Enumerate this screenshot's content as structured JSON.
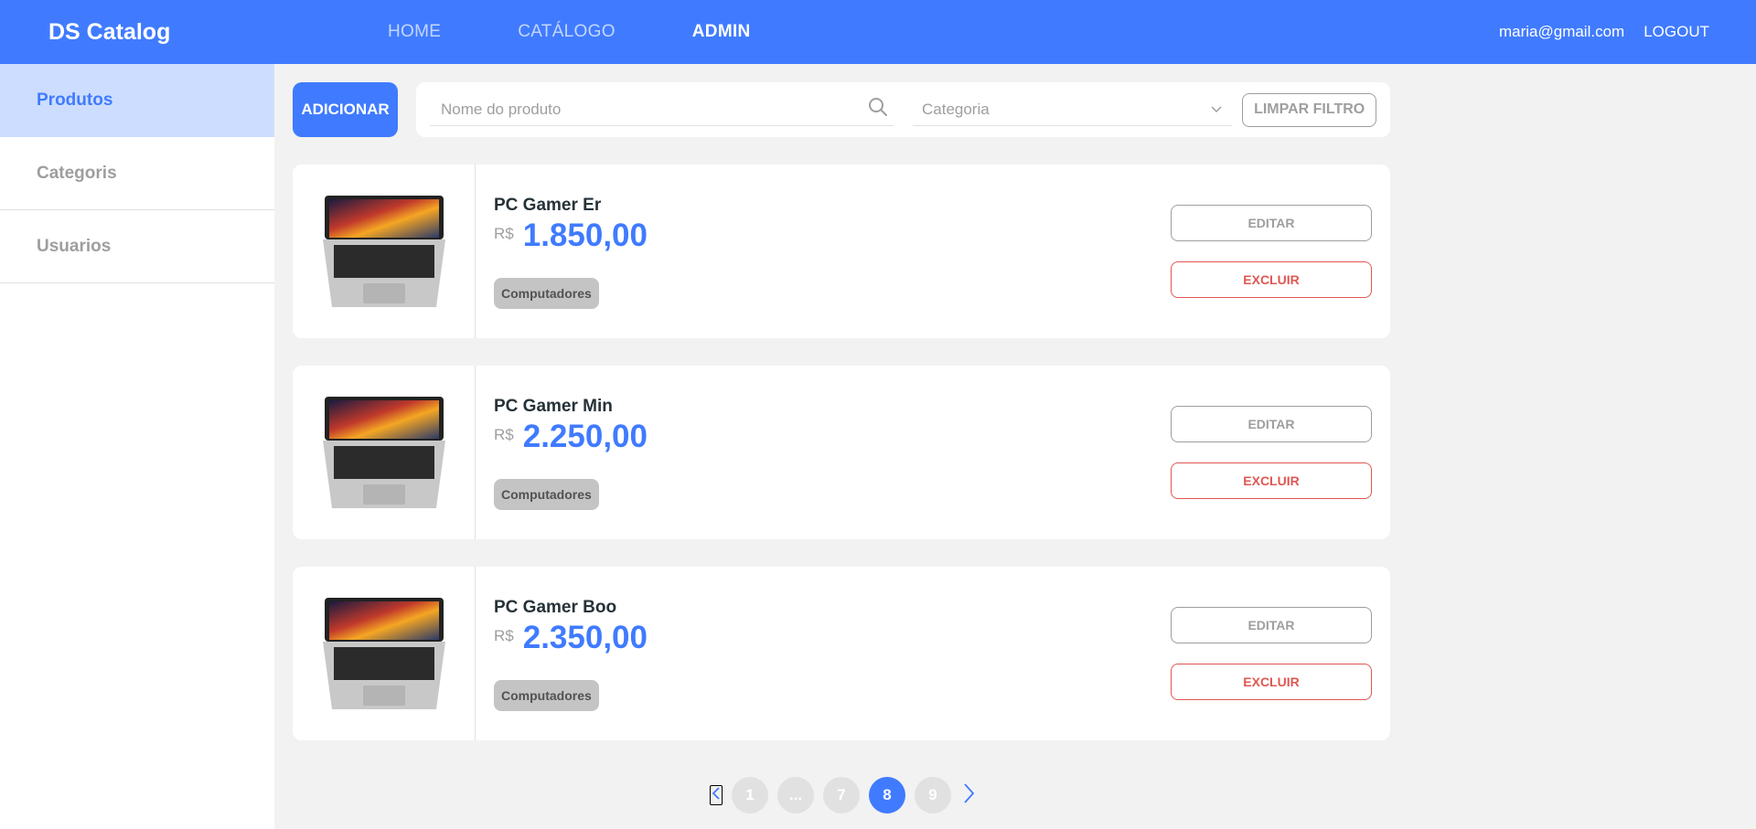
{
  "navbar": {
    "brand": "DS Catalog",
    "links": [
      {
        "label": "HOME"
      },
      {
        "label": "CATÁLOGO"
      },
      {
        "label": "ADMIN"
      }
    ],
    "user_email": "maria@gmail.com",
    "logout_label": "LOGOUT",
    "bg_color": "#407bff"
  },
  "sidebar": {
    "items": [
      {
        "label": "Produtos"
      },
      {
        "label": "Categoris"
      },
      {
        "label": "Usuarios"
      }
    ]
  },
  "filters": {
    "add_label": "ADICIONAR",
    "search_placeholder": "Nome do produto",
    "category_placeholder": "Categoria",
    "clear_label": "LIMPAR FILTRO"
  },
  "products": [
    {
      "name": "PC Gamer Er",
      "currency": "R$",
      "price": "1.850,00",
      "category": "Computadores",
      "edit_label": "EDITAR",
      "delete_label": "EXCLUIR"
    },
    {
      "name": "PC Gamer Min",
      "currency": "R$",
      "price": "2.250,00",
      "category": "Computadores",
      "edit_label": "EDITAR",
      "delete_label": "EXCLUIR"
    },
    {
      "name": "PC Gamer Boo",
      "currency": "R$",
      "price": "2.350,00",
      "category": "Computadores",
      "edit_label": "EDITAR",
      "delete_label": "EXCLUIR"
    }
  ],
  "pagination": {
    "pages": [
      "1",
      "...",
      "7",
      "8",
      "9"
    ],
    "current": "8"
  }
}
